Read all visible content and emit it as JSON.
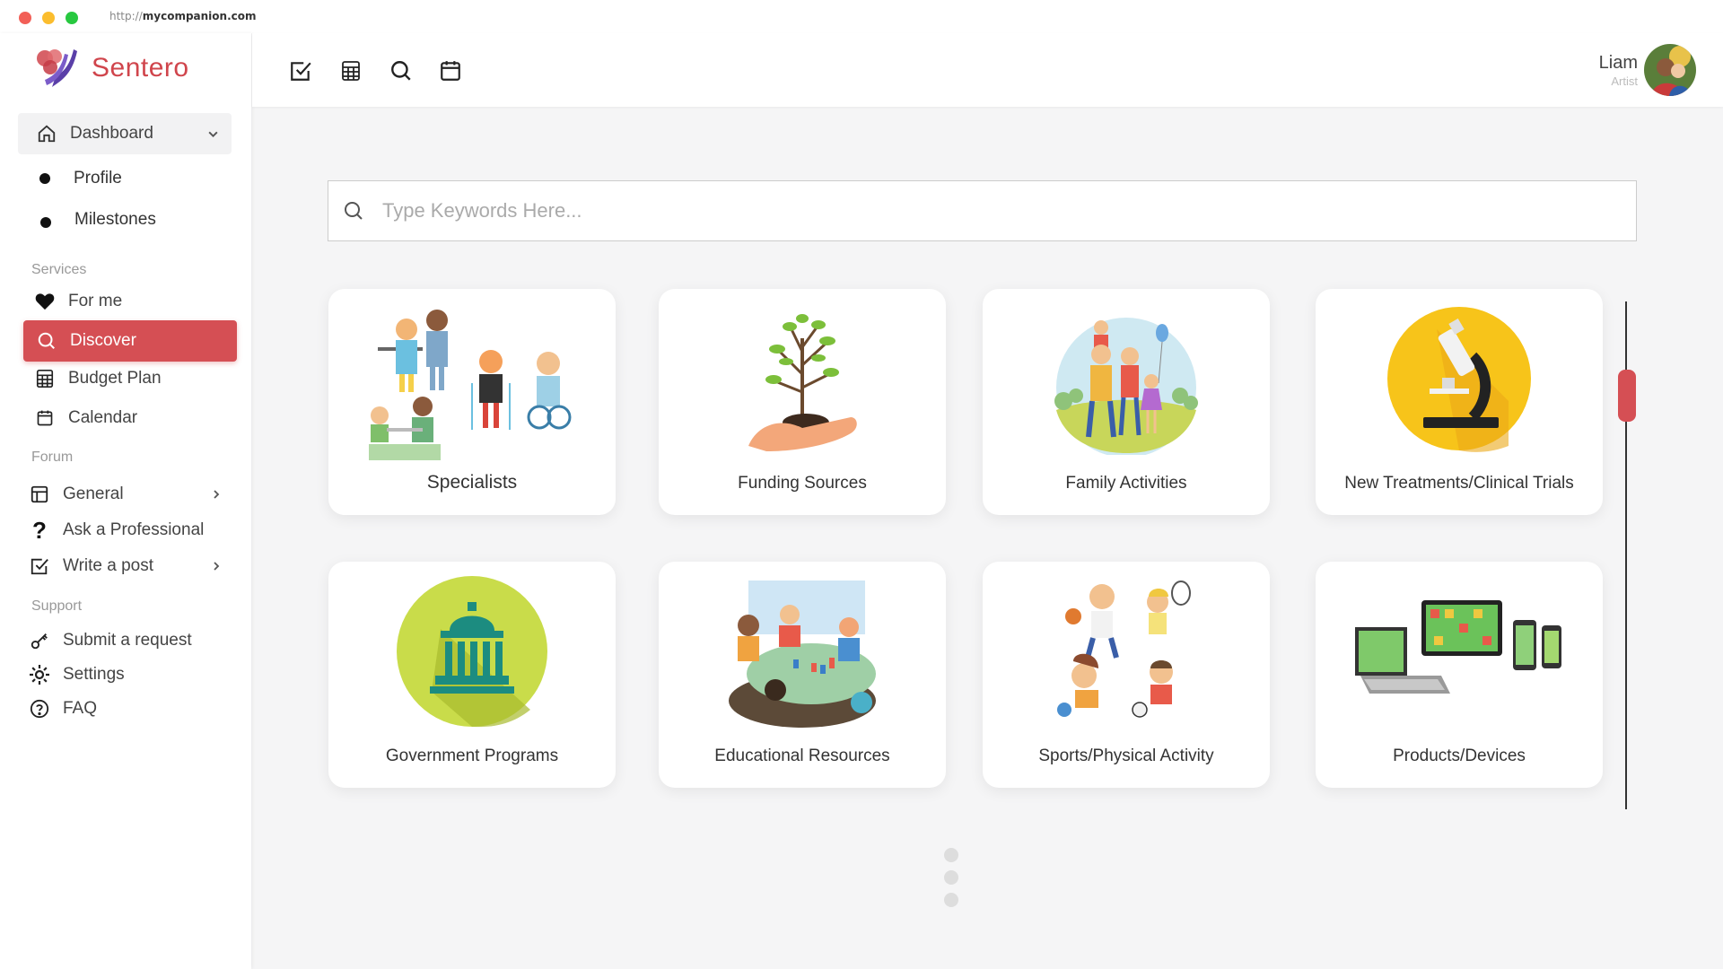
{
  "browser": {
    "url_protocol": "http://",
    "url_host": "mycompanion.com"
  },
  "brand": {
    "name": "Sentero"
  },
  "sidebar": {
    "dashboard": "Dashboard",
    "dashboard_sub": [
      "Profile",
      "Milestones"
    ],
    "services_label": "Services",
    "services": [
      "For me",
      "Discover",
      "Budget Plan",
      "Calendar"
    ],
    "forum_label": "Forum",
    "forum": [
      "General",
      "Ask a Professional",
      "Write a post"
    ],
    "support_label": "Support",
    "support": [
      "Submit a request",
      "Settings",
      "FAQ"
    ]
  },
  "topbar": {
    "icons": [
      "checkbox-icon",
      "table-icon",
      "search-icon",
      "calendar-icon"
    ]
  },
  "user": {
    "name": "Liam",
    "role": "Artist"
  },
  "search": {
    "placeholder": "Type Keywords Here..."
  },
  "categories": [
    "Specialists",
    "Funding Sources",
    "Family Activities",
    "New Treatments/Clinical Trials",
    "Government Programs",
    "Educational Resources",
    "Sports/Physical Activity",
    "Products/Devices"
  ],
  "colors": {
    "accent": "#d54f54",
    "brand": "#d0454c",
    "government_circle": "#c9dc4a",
    "treatments_circle": "#f7c41a"
  }
}
